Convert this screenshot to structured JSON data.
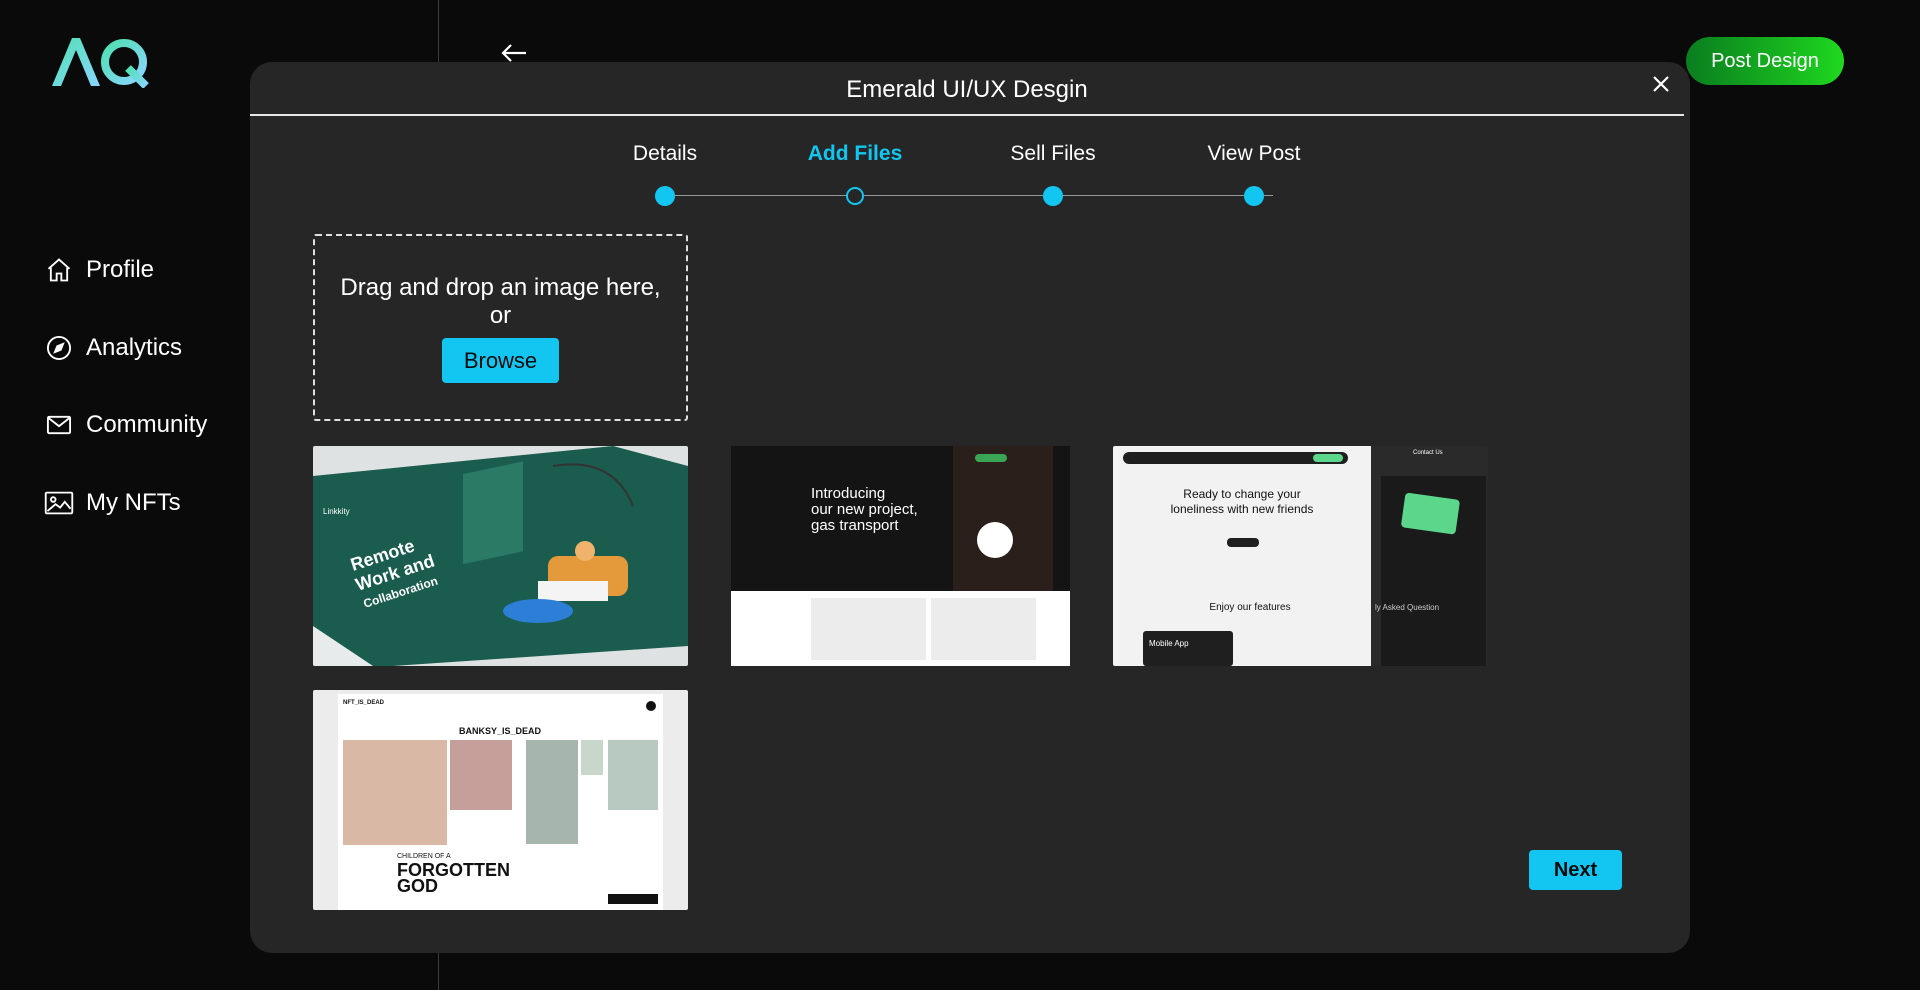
{
  "sidebar": {
    "items": [
      {
        "label": "Profile",
        "icon": "home-icon"
      },
      {
        "label": "Analytics",
        "icon": "compass-icon"
      },
      {
        "label": "Community",
        "icon": "mail-icon"
      },
      {
        "label": "My NFTs",
        "icon": "image-icon"
      }
    ]
  },
  "header": {
    "post_label": "Post Design"
  },
  "modal": {
    "title": "Emerald UI/UX Desgin",
    "steps": [
      "Details",
      "Add Files",
      "Sell Files",
      "View Post"
    ],
    "active_step": 1,
    "dropzone": {
      "text": "Drag and drop an image here, or",
      "browse_label": "Browse"
    },
    "thumbnails": {
      "t1": {
        "brand": "Linkkity",
        "headline": "Remote Work and Collaboration"
      },
      "t2": {
        "headline1": "Introducing",
        "headline2": "our new project,",
        "headline3": "gas transport"
      },
      "t3": {
        "headline1": "Ready to change your",
        "headline2": "loneliness with new friends",
        "features": "Enjoy our features",
        "card": "Mobile App",
        "faq": "ly Asked Question",
        "contact": "Contact Us"
      },
      "t4": {
        "top": "NFT_IS_DEAD",
        "title": "BANKSY_IS_DEAD",
        "children": "CHILDREN OF A",
        "forgotten1": "FORGOTTEN",
        "forgotten2": "GOD"
      }
    },
    "next_label": "Next"
  },
  "colors": {
    "accent": "#13c6f2",
    "post_gradient_start": "#0a7d1f",
    "post_gradient_end": "#1fd81f",
    "modal_bg": "#262626",
    "page_bg": "#0a0a0a"
  }
}
